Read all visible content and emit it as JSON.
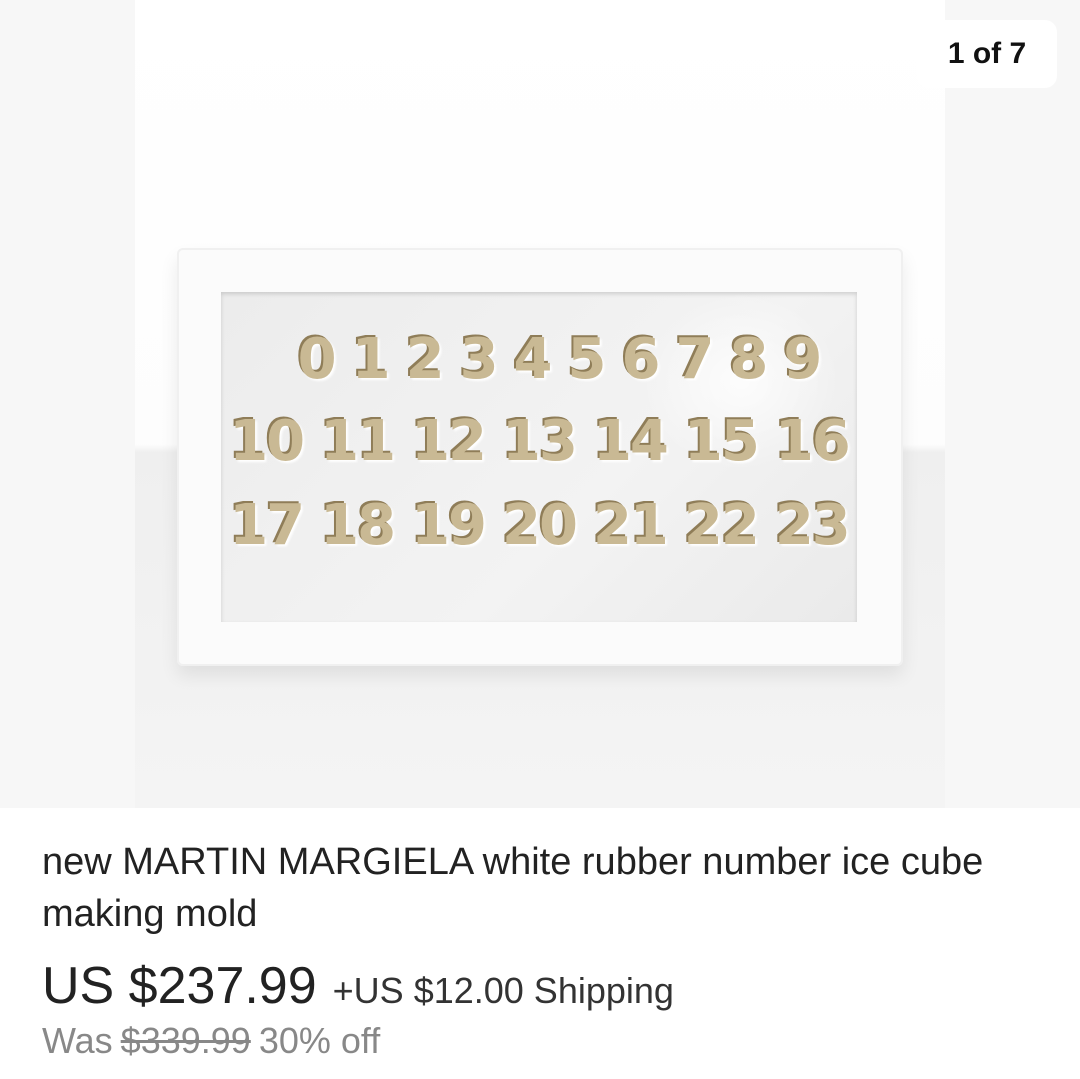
{
  "gallery": {
    "counter": "1 of 7",
    "mold_rows": [
      [
        "0",
        "1",
        "2",
        "3",
        "4",
        "5",
        "6",
        "7",
        "8",
        "9"
      ],
      [
        "10",
        "11",
        "12",
        "13",
        "14",
        "15",
        "16"
      ],
      [
        "17",
        "18",
        "19",
        "20",
        "21",
        "22",
        "23"
      ]
    ]
  },
  "listing": {
    "title": "new MARTIN MARGIELA white rubber number ice cube making mold",
    "price": "US $237.99",
    "shipping": "+US $12.00 Shipping",
    "was_label": "Was",
    "was_price": "$339.99",
    "discount": "30% off"
  }
}
